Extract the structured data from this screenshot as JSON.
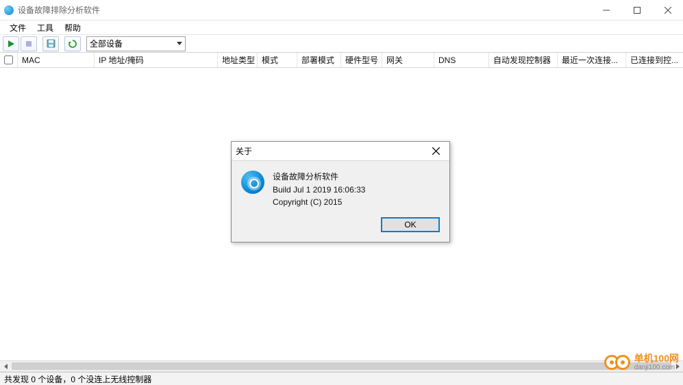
{
  "window": {
    "title": "设备故障排除分析软件"
  },
  "menu": {
    "items": [
      "文件",
      "工具",
      "帮助"
    ]
  },
  "toolbar": {
    "combo": {
      "selected": "全部设备"
    }
  },
  "columns": {
    "mac": "MAC",
    "ip": "IP 地址/掩码",
    "addr_type": "地址类型",
    "mode": "模式",
    "deploy_mode": "部署模式",
    "hw_model": "硬件型号",
    "gateway": "网关",
    "dns": "DNS",
    "discovered_ctrl": "自动发现控制器",
    "last_connect": "最近一次连接...",
    "connected_ctrl": "已连接到控..."
  },
  "status": {
    "text": "共发现 0 个设备，0 个没连上无线控制器"
  },
  "about": {
    "title": "关于",
    "product": "设备故障分析软件",
    "build": "Build Jul  1 2019 16:06:33",
    "copyright": "Copyright (C) 2015",
    "ok": "OK"
  },
  "watermark": {
    "line1": "单机100网",
    "line2": "danji100.com"
  }
}
